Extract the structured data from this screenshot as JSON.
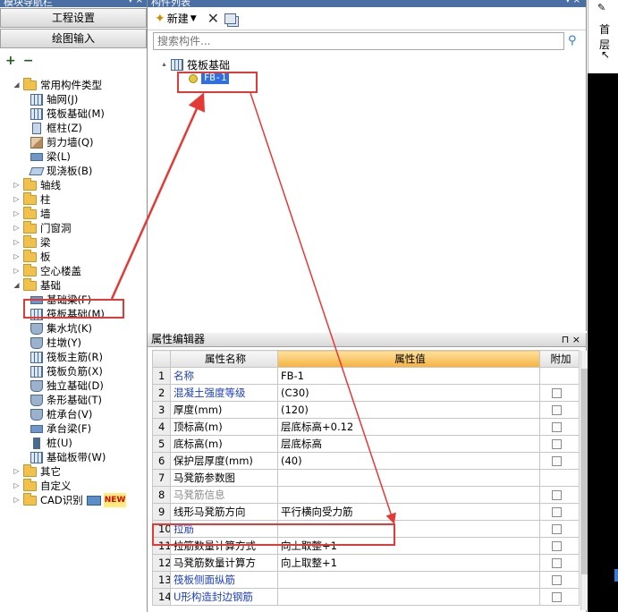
{
  "left_panel": {
    "title": "模块导航栏",
    "nav_buttons": [
      "工程设置",
      "绘图输入"
    ],
    "tree": [
      {
        "label": "常用构件类型",
        "level": 0,
        "type": "folder",
        "expanded": true
      },
      {
        "label": "轴网(J)",
        "level": 1,
        "type": "grid"
      },
      {
        "label": "筏板基础(M)",
        "level": 1,
        "type": "grid"
      },
      {
        "label": "框柱(Z)",
        "level": 1,
        "type": "col"
      },
      {
        "label": "剪力墙(Q)",
        "level": 1,
        "type": "wall"
      },
      {
        "label": "梁(L)",
        "level": 1,
        "type": "beam"
      },
      {
        "label": "现浇板(B)",
        "level": 1,
        "type": "slab"
      },
      {
        "label": "轴线",
        "level": 0,
        "type": "folder"
      },
      {
        "label": "柱",
        "level": 0,
        "type": "folder"
      },
      {
        "label": "墙",
        "level": 0,
        "type": "folder"
      },
      {
        "label": "门窗洞",
        "level": 0,
        "type": "folder"
      },
      {
        "label": "梁",
        "level": 0,
        "type": "folder"
      },
      {
        "label": "板",
        "level": 0,
        "type": "folder"
      },
      {
        "label": "空心楼盖",
        "level": 0,
        "type": "folder"
      },
      {
        "label": "基础",
        "level": 0,
        "type": "folder",
        "expanded": true
      },
      {
        "label": "基础梁(F)",
        "level": 1,
        "type": "beam"
      },
      {
        "label": "筏板基础(M)",
        "level": 1,
        "type": "grid"
      },
      {
        "label": "集水坑(K)",
        "level": 1,
        "type": "foot"
      },
      {
        "label": "柱墩(Y)",
        "level": 1,
        "type": "foot"
      },
      {
        "label": "筏板主筋(R)",
        "level": 1,
        "type": "grid"
      },
      {
        "label": "筏板负筋(X)",
        "level": 1,
        "type": "grid"
      },
      {
        "label": "独立基础(D)",
        "level": 1,
        "type": "foot"
      },
      {
        "label": "条形基础(T)",
        "level": 1,
        "type": "foot"
      },
      {
        "label": "桩承台(V)",
        "level": 1,
        "type": "foot"
      },
      {
        "label": "承台梁(F)",
        "level": 1,
        "type": "beam"
      },
      {
        "label": "桩(U)",
        "level": 1,
        "type": "pile"
      },
      {
        "label": "基础板带(W)",
        "level": 1,
        "type": "grid"
      },
      {
        "label": "其它",
        "level": 0,
        "type": "folder"
      },
      {
        "label": "自定义",
        "level": 0,
        "type": "folder"
      },
      {
        "label": "CAD识别",
        "level": 0,
        "type": "folder",
        "badge": "NEW"
      }
    ]
  },
  "component_list": {
    "title": "构件列表",
    "new_label": "新建",
    "search_placeholder": "搜索构件...",
    "root_label": "筏板基础",
    "child_label": "FB-1"
  },
  "property_editor": {
    "title": "属性编辑器",
    "columns": [
      "属性名称",
      "属性值",
      "附加"
    ],
    "rows": [
      {
        "num": "1",
        "name": "名称",
        "value": "FB-1",
        "style": "blue",
        "check": false
      },
      {
        "num": "2",
        "name": "混凝土强度等级",
        "value": "(C30)",
        "style": "blue",
        "check": true
      },
      {
        "num": "3",
        "name": "厚度(mm)",
        "value": "(120)",
        "style": "",
        "check": true
      },
      {
        "num": "4",
        "name": "顶标高(m)",
        "value": "层底标高+0.12",
        "style": "",
        "check": true
      },
      {
        "num": "5",
        "name": "底标高(m)",
        "value": "层底标高",
        "style": "",
        "check": true
      },
      {
        "num": "6",
        "name": "保护层厚度(mm)",
        "value": "(40)",
        "style": "",
        "check": true
      },
      {
        "num": "7",
        "name": "马凳筋参数图",
        "value": "",
        "style": "",
        "check": false
      },
      {
        "num": "8",
        "name": "马凳筋信息",
        "value": "",
        "style": "gray",
        "check": true
      },
      {
        "num": "9",
        "name": "线形马凳筋方向",
        "value": "平行横向受力筋",
        "style": "",
        "check": true
      },
      {
        "num": "10",
        "name": "拉筋",
        "value": "",
        "style": "blue",
        "check": true
      },
      {
        "num": "11",
        "name": "拉筋数量计算方式",
        "value": "向上取整+1",
        "style": "",
        "check": true
      },
      {
        "num": "12",
        "name": "马凳筋数量计算方",
        "value": "向上取整+1",
        "style": "",
        "check": true
      },
      {
        "num": "13",
        "name": "筏板侧面纵筋",
        "value": "",
        "style": "blue",
        "check": true
      },
      {
        "num": "14",
        "name": "U形构造封边钢筋",
        "value": "",
        "style": "blue",
        "check": true
      }
    ]
  },
  "right_edge": {
    "floor_label": "首层"
  },
  "colors": {
    "annotation": "#e53935",
    "selection": "#2f6fe0",
    "value_header": "#f5b23e",
    "link_text": "#1b3fbf"
  }
}
